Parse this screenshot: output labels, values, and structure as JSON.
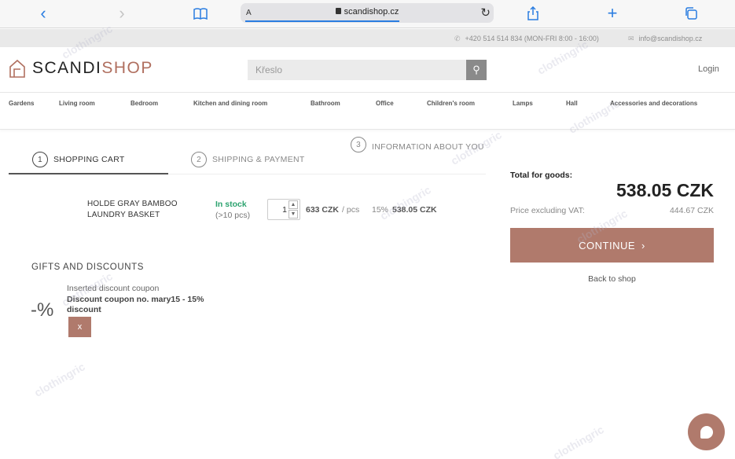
{
  "browser": {
    "text_size": "A",
    "url": "scandishop.cz"
  },
  "topbar": {
    "phone": "+420 514 514 834 (MON-FRI 8:00 - 16:00)",
    "email": "info@scandishop.cz"
  },
  "header": {
    "logo_main": "SCANDI",
    "logo_accent": "SHOP",
    "search_placeholder": "Křeslo",
    "login": "Login"
  },
  "categories": [
    "Gardens",
    "Living room",
    "Bedroom",
    "Kitchen and dining room",
    "Bathroom",
    "Office",
    "Children's room",
    "Lamps",
    "Hall",
    "Accessories and decorations"
  ],
  "steps": [
    {
      "num": "1",
      "label": "SHOPPING CART"
    },
    {
      "num": "2",
      "label": "SHIPPING & PAYMENT"
    },
    {
      "num": "3",
      "label": "INFORMATION ABOUT YOU"
    }
  ],
  "cart_item": {
    "name": "HOLDE GRAY BAMBOO LAUNDRY BASKET",
    "stock_status": "In stock",
    "stock_count": "(>10 pcs)",
    "quantity": "1",
    "unit_price": "633 CZK",
    "unit": "/ pcs",
    "vat": "15%",
    "total": "538.05 CZK"
  },
  "summary": {
    "total_label": "Total for goods:",
    "total_value": "538.05 CZK",
    "exvat_label": "Price excluding VAT:",
    "exvat_value": "444.67 CZK",
    "continue": "CONTINUE",
    "back": "Back to shop"
  },
  "discounts": {
    "title": "GIFTS AND DISCOUNTS",
    "symbol": "-%",
    "coupon_label": "Inserted discount coupon",
    "coupon_name": "Discount coupon no. mary15 - 15% discount",
    "remove": "x"
  },
  "watermark": "clothingric",
  "colors": {
    "accent": "#b07a6c",
    "in_stock": "#2ca36f",
    "browser_blue": "#2a7de1"
  }
}
